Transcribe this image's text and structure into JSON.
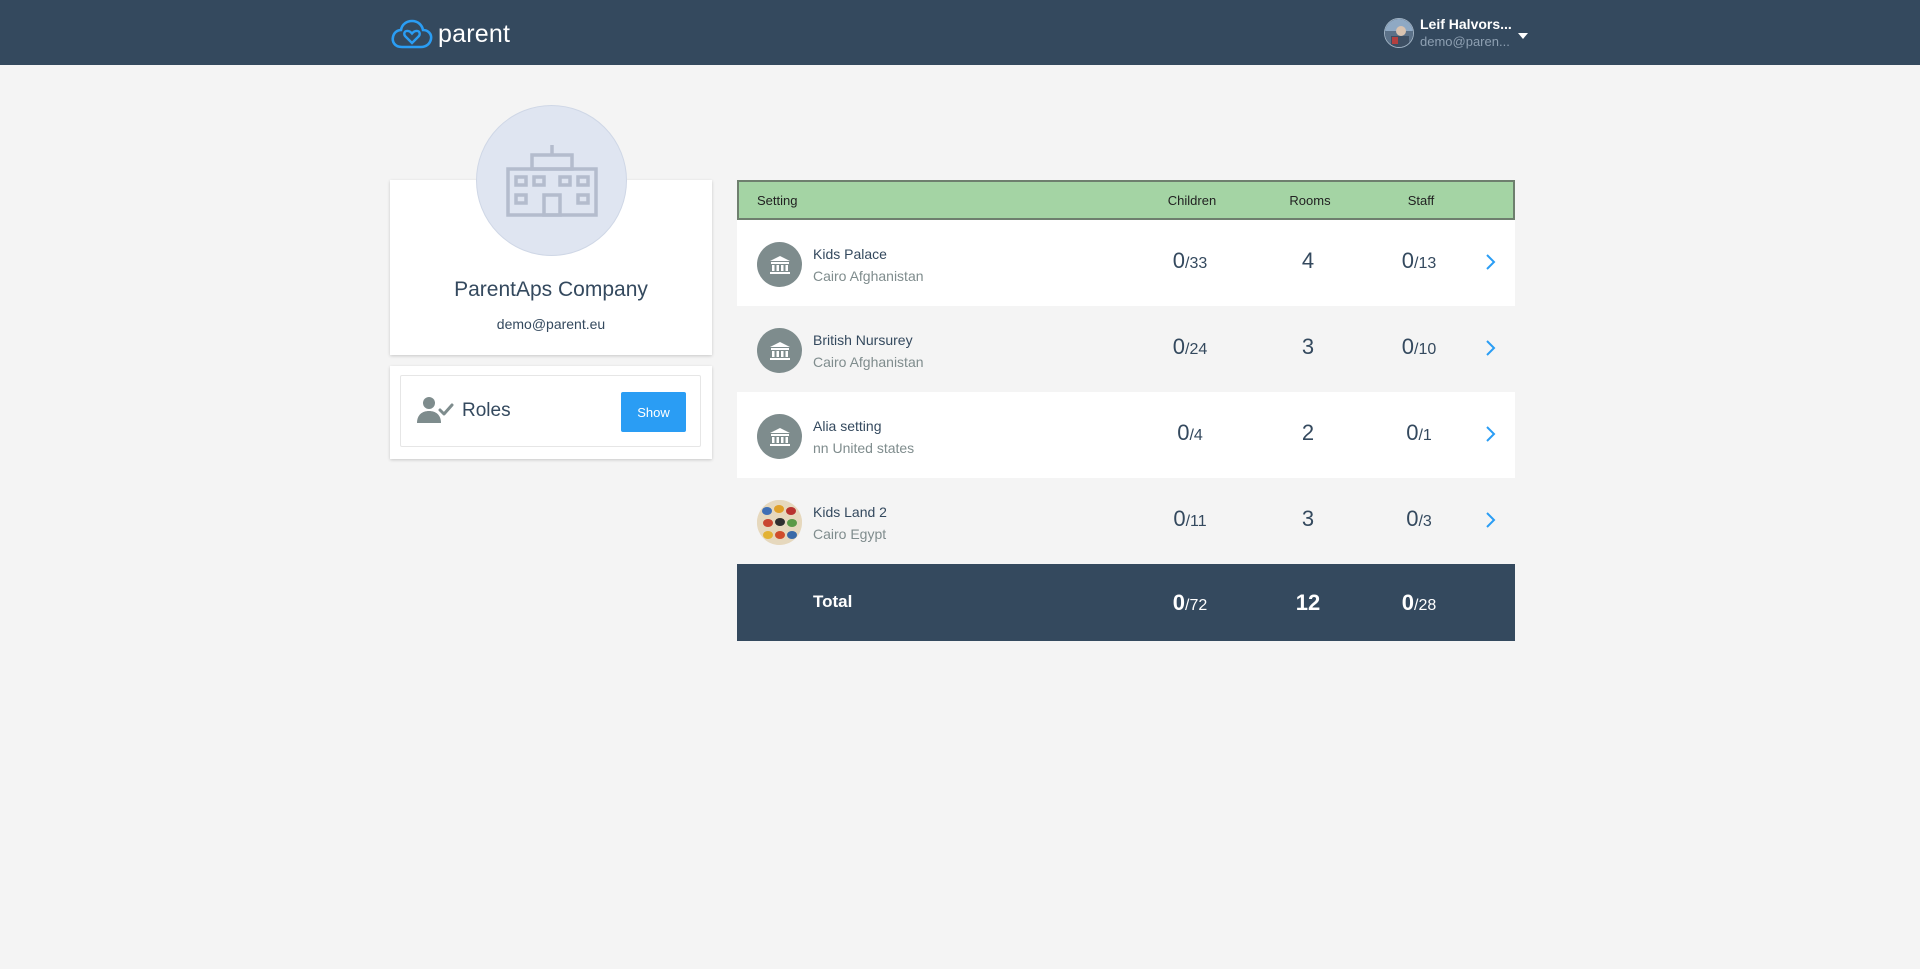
{
  "header": {
    "brand": "parent",
    "user": {
      "name": "Leif Halvors...",
      "email": "demo@paren..."
    }
  },
  "company": {
    "name": "ParentAps Company",
    "email": "demo@parent.eu"
  },
  "roles": {
    "label": "Roles",
    "button_label": "Show"
  },
  "table": {
    "columns": [
      "Setting",
      "Children",
      "Rooms",
      "Staff"
    ],
    "rows": [
      {
        "name": "Kids Palace",
        "location": "Cairo Afghanistan",
        "children_current": "0",
        "children_total": "/33",
        "rooms": "4",
        "staff_current": "0",
        "staff_total": "/13",
        "avatar_icon": "institution-icon"
      },
      {
        "name": "British Nursurey",
        "location": "Cairo Afghanistan",
        "children_current": "0",
        "children_total": "/24",
        "rooms": "3",
        "staff_current": "0",
        "staff_total": "/10",
        "avatar_icon": "institution-icon"
      },
      {
        "name": "Alia setting",
        "location": "nn United states",
        "children_current": "0",
        "children_total": "/4",
        "rooms": "2",
        "staff_current": "0",
        "staff_total": "/1",
        "avatar_icon": "institution-icon"
      },
      {
        "name": "Kids Land 2",
        "location": "Cairo Egypt",
        "children_current": "0",
        "children_total": "/11",
        "rooms": "3",
        "staff_current": "0",
        "staff_total": "/3",
        "avatar_icon": "butterflies-photo"
      }
    ],
    "total": {
      "label": "Total",
      "children_current": "0",
      "children_total": "/72",
      "rooms": "12",
      "staff_current": "0",
      "staff_total": "/28"
    }
  },
  "colors": {
    "topbar": "#34495e",
    "accent": "#2a9df4",
    "table_header": "#a4d4a4",
    "footer": "#34495e",
    "page_bg": "#f4f4f4"
  }
}
